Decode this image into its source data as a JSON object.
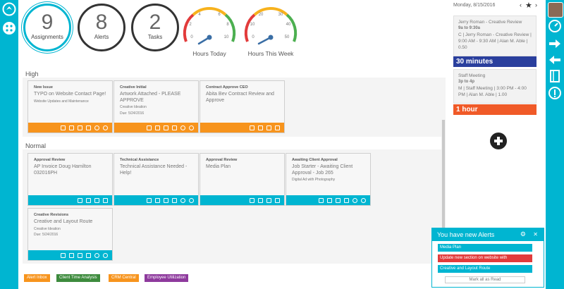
{
  "stats": {
    "assignments": {
      "count": "9",
      "label": "Assignments"
    },
    "alerts": {
      "count": "8",
      "label": "Alerts"
    },
    "tasks": {
      "count": "2",
      "label": "Tasks"
    }
  },
  "gauges": [
    {
      "label": "Hours Today",
      "ticks": [
        "0",
        "2",
        "4",
        "6",
        "8",
        "10"
      ],
      "value": 3
    },
    {
      "label": "Hours This Week",
      "ticks": [
        "0",
        "10",
        "20",
        "30",
        "40",
        "50"
      ],
      "value": 20
    }
  ],
  "sections": {
    "high": "High",
    "normal": "Normal"
  },
  "high_cards": [
    {
      "type": "New Issue",
      "title": "TYPO on Website Contact Page!",
      "meta1": "Website Updates and Maintenance",
      "meta2": ""
    },
    {
      "type": "Creative Initial",
      "title": "Artwork Attached - PLEASE APPROVE",
      "meta1": "Creative Ideation",
      "meta2": "Due: 5/24/2016"
    },
    {
      "type": "Contract Approve CEO",
      "title": "Abita Bev Contract Review and Approve",
      "meta1": "",
      "meta2": ""
    }
  ],
  "normal_cards": [
    {
      "type": "Approval Review",
      "title": "AP Invoice Doug Hamilton 032016PH",
      "meta1": "",
      "meta2": ""
    },
    {
      "type": "Technical Assistance",
      "title": "Technical Assistance Needed - Help!",
      "meta1": "",
      "meta2": ""
    },
    {
      "type": "Approval Review",
      "title": "Media Plan",
      "meta1": "",
      "meta2": ""
    },
    {
      "type": "Awaiting Client Approval",
      "title": "Job Starter - Awaiting Client Approval - Job 265",
      "meta1": "Digital Ad with Photography",
      "meta2": ""
    },
    {
      "type": "Creative Revisions",
      "title": "Creative and Layout Route",
      "meta1": "Creative Ideation",
      "meta2": "Due: 5/24/2016"
    }
  ],
  "bottom_buttons": [
    {
      "label": "Alert Inbox",
      "color": "#f7941d"
    },
    {
      "label": "Client Time Analysis",
      "color": "#3d8b3d"
    },
    {
      "label": "CRM Central",
      "color": "#f7941d"
    },
    {
      "label": "Employee Utilization",
      "color": "#8e3a9d"
    }
  ],
  "calendar": {
    "date": "Monday, 8/15/2016",
    "events": [
      {
        "name": "Jerry Roman - Creative Review",
        "time": "9a to 9:30a",
        "detail": "C | Jerry Roman - Creative Review | 9:00 AM - 9:30 AM | Alan M. Able | 0.50",
        "duration": "30 minutes",
        "duration_color": "#2a3f9d"
      },
      {
        "name": "Staff Meeting",
        "time": "3p to 4p",
        "detail": "M | Staff Meeting | 3:00 PM - 4:00 PM | Alan M. Able | 1.00",
        "duration": "1 hour",
        "duration_color": "#f05a28"
      }
    ]
  },
  "alerts_panel": {
    "title": "You have new Alerts",
    "items": [
      {
        "label": "Media Plan",
        "color": "#00b5d1"
      },
      {
        "label": "Update new section on website with",
        "color": "#e23b3b"
      },
      {
        "label": "Creative and Layout Route",
        "color": "#00b5d1"
      }
    ],
    "mark_all": "Mark all as Read"
  }
}
